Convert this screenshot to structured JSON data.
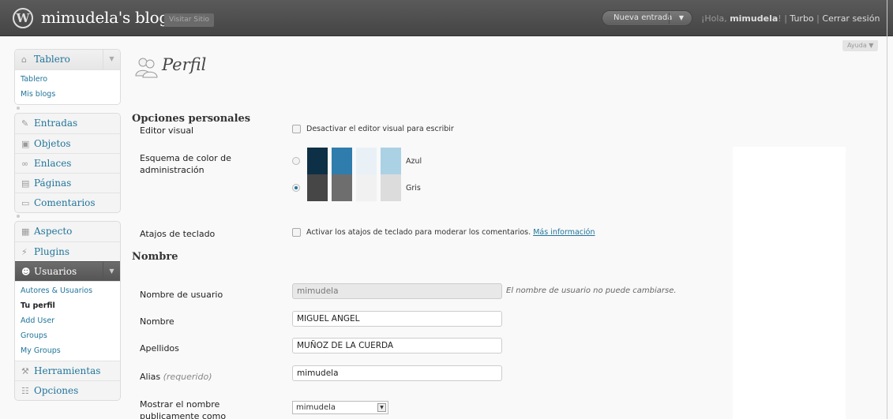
{
  "header": {
    "site_title": "mimudela's blog",
    "visit_site": "Visitar Sitio",
    "new_entry": "Nueva entrada",
    "greeting": "¡Hola, ",
    "username": "mimudela",
    "greeting_end": "!",
    "turbo": "Turbo",
    "logout": "Cerrar sesión",
    "separator": "|"
  },
  "help": "Ayuda",
  "sidebar": {
    "dashboard": "Tablero",
    "dashboard_sub": [
      "Tablero",
      "Mis blogs"
    ],
    "items": [
      "Entradas",
      "Objetos",
      "Enlaces",
      "Páginas",
      "Comentarios"
    ],
    "aspect": "Aspecto",
    "plugins": "Plugins",
    "users": "Usuarios",
    "users_sub": [
      "Autores & Usuarios",
      "Tu perfil",
      "Add User",
      "Groups",
      "My Groups"
    ],
    "tools": "Herramientas",
    "options": "Opciones"
  },
  "page": {
    "title": "Perfil",
    "section_personal": "Opciones personales",
    "visual_editor_label": "Editor visual",
    "visual_editor_checkbox": "Desactivar el editor visual para escribir",
    "color_scheme_label": "Esquema de color de administración",
    "schemes": [
      {
        "name": "Azul",
        "selected": false,
        "colors": [
          "#0e3046",
          "#2e7dad",
          "#e9f1f7",
          "#abd1e5"
        ]
      },
      {
        "name": "Gris",
        "selected": true,
        "colors": [
          "#464646",
          "#6e6e6e",
          "#f1f1f1",
          "#dcdcdc"
        ]
      }
    ],
    "shortcuts_label": "Atajos de teclado",
    "shortcuts_checkbox": "Activar los atajos de teclado para moderar los comentarios.",
    "shortcuts_link": "Más información",
    "section_name": "Nombre",
    "username_label": "Nombre de usuario",
    "username_value": "mimudela",
    "username_note": "El nombre de usuario no puede cambiarse.",
    "first_name_label": "Nombre",
    "first_name_value": "MIGUEL ANGEL",
    "last_name_label": "Apellidos",
    "last_name_value": "MUÑOZ DE LA CUERDA",
    "nickname_label": "Alias",
    "nickname_required": "(requerido)",
    "nickname_value": "mimudela",
    "display_label": "Mostrar el nombre publicamente como",
    "display_value": "mimudela"
  }
}
